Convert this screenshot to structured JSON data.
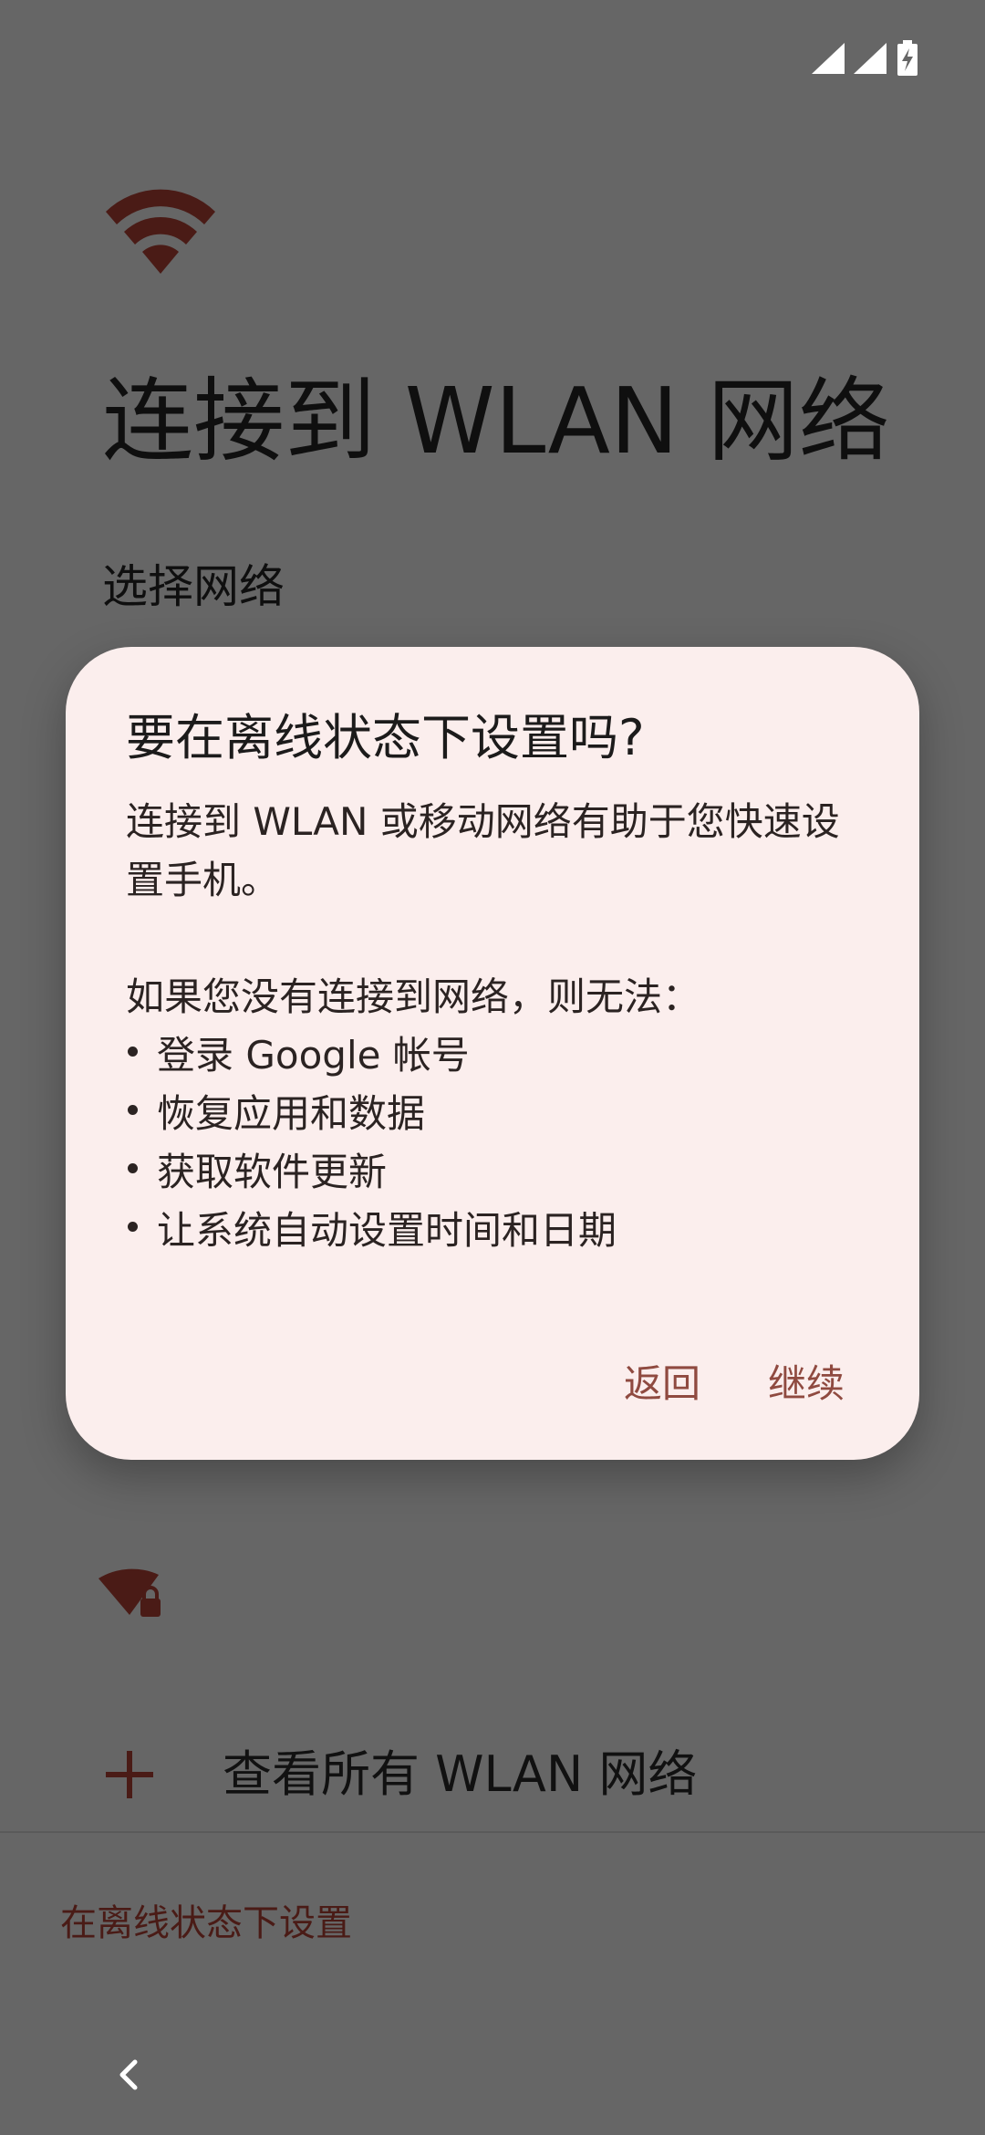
{
  "status_bar": {
    "signal_icon_1": "cellular-signal-icon",
    "signal_icon_2": "cellular-signal-icon",
    "battery_icon": "battery-charging-icon"
  },
  "page": {
    "header_icon": "wifi-icon",
    "title": "连接到 WLAN 网络",
    "section_label": "选择网络",
    "network_icon": "wifi-lock-icon",
    "see_all_label": "查看所有 WLAN 网络",
    "offline_link": "在离线状态下设置",
    "back_icon": "chevron-left-icon"
  },
  "dialog": {
    "title": "要在离线状态下设置吗?",
    "intro": "连接到 WLAN 或移动网络有助于您快速设置手机。",
    "list_heading": "如果您没有连接到网络，则无法：",
    "items": [
      "登录 Google 帐号",
      "恢复应用和数据",
      "获取软件更新",
      "让系统自动设置时间和日期"
    ],
    "back_label": "返回",
    "continue_label": "继续"
  },
  "colors": {
    "scrim_background": "#666666",
    "dialog_background": "#fbeeed",
    "accent": "#8f4a40",
    "icon_dark": "#4a1b16"
  }
}
